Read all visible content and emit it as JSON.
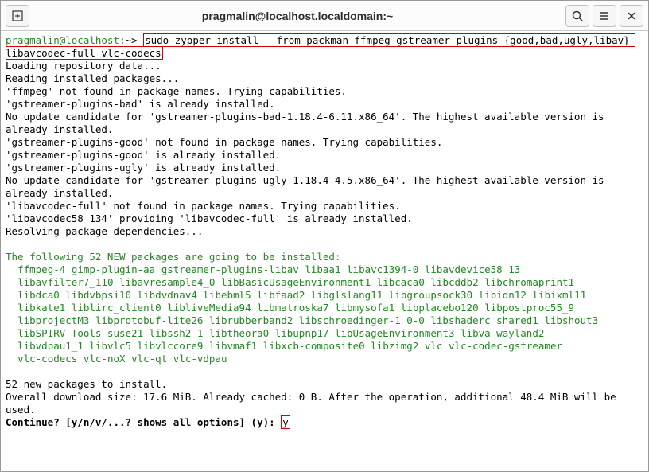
{
  "titlebar": {
    "title": "pragmalin@localhost.localdomain:~"
  },
  "prompt": {
    "user_host": "pragmalin@localhost",
    "path": ":~> ",
    "command": "sudo zypper install --from packman ffmpeg gstreamer-plugins-{good,bad,ugly,libav} libavcodec-full vlc-codecs"
  },
  "output": {
    "line1": "Loading repository data...",
    "line2": "Reading installed packages...",
    "line3": "'ffmpeg' not found in package names. Trying capabilities.",
    "line4": "'gstreamer-plugins-bad' is already installed.",
    "line5": "No update candidate for 'gstreamer-plugins-bad-1.18.4-6.11.x86_64'. The highest available version is already installed.",
    "line6": "'gstreamer-plugins-good' not found in package names. Trying capabilities.",
    "line7": "'gstreamer-plugins-good' is already installed.",
    "line8": "'gstreamer-plugins-ugly' is already installed.",
    "line9": "No update candidate for 'gstreamer-plugins-ugly-1.18.4-4.5.x86_64'. The highest available version is already installed.",
    "line10": "'libavcodec-full' not found in package names. Trying capabilities.",
    "line11": "'libavcodec58_134' providing 'libavcodec-full' is already installed.",
    "line12": "Resolving package dependencies..."
  },
  "install_header": "The following 52 NEW packages are going to be installed:",
  "packages": {
    "p1": "ffmpeg-4",
    "p2": "gimp-plugin-aa",
    "p3": "gstreamer-plugins-libav",
    "p4": "libaa1",
    "p5": "libavc1394-0",
    "p6": "libavdevice58_13",
    "p7": "libavfilter7_110",
    "p8": "libavresample4_0",
    "p9": "libBasicUsageEnvironment1",
    "p10": "libcaca0",
    "p11": "libcddb2",
    "p12": "libchromaprint1",
    "p13": "libdca0",
    "p14": "libdvbpsi10",
    "p15": "libdvdnav4",
    "p16": "libebml5",
    "p17": "libfaad2",
    "p18": "libglslang11",
    "p19": "libgroupsock30",
    "p20": "libidn12",
    "p21": "libixml11",
    "p22": "libkate1",
    "p23": "liblirc_client0",
    "p24": "libliveMedia94",
    "p25": "libmatroska7",
    "p26": "libmysofa1",
    "p27": "libplacebo120",
    "p28": "libpostproc55_9",
    "p29": "libprojectM3",
    "p30": "libprotobuf-lite26",
    "p31": "librubberband2",
    "p32": "libschroedinger-1_0-0",
    "p33": "libshaderc_shared1",
    "p34": "libshout3",
    "p35": "libSPIRV-Tools-suse21",
    "p36": "libssh2-1",
    "p37": "libtheora0",
    "p38": "libupnp17",
    "p39": "libUsageEnvironment3",
    "p40": "libva-wayland2",
    "p41": "libvdpau1_1",
    "p42": "libvlc5",
    "p43": "libvlccore9",
    "p44": "libvmaf1",
    "p45": "libxcb-composite0",
    "p46": "libzimg2",
    "p47": "vlc",
    "p48": "vlc-codec-gstreamer",
    "p49": "vlc-codecs",
    "p50": "vlc-noX",
    "p51": "vlc-qt",
    "p52": "vlc-vdpau"
  },
  "summary": {
    "line1": "52 new packages to install.",
    "line2": "Overall download size: 17.6 MiB. Already cached: 0 B. After the operation, additional 48.4 MiB will be used.",
    "prompt": "Continue? [y/n/v/...? shows all options] (y): ",
    "answer": "y"
  }
}
